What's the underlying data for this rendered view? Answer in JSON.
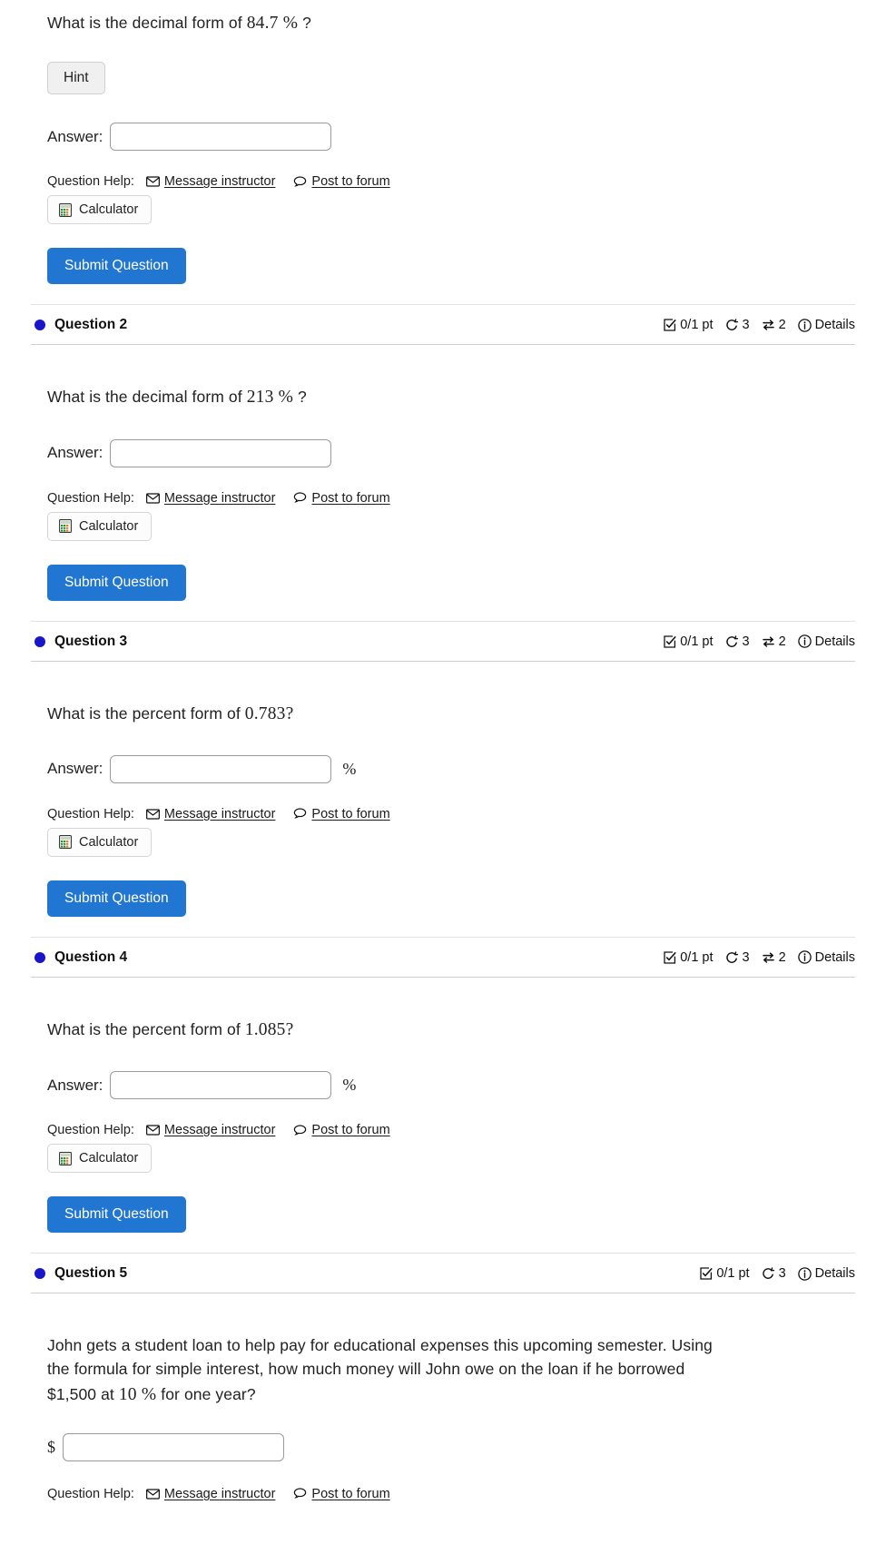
{
  "common": {
    "answer_label": "Answer:",
    "answer_value": "",
    "answer_placeholder": "",
    "question_help_label": "Question Help:",
    "message_instructor": "Message instructor",
    "post_to_forum": "Post to forum",
    "calculator": "Calculator",
    "submit": "Submit Question",
    "hint": "Hint",
    "percent_unit": "%",
    "dollar_unit": "$",
    "details": "Details",
    "icons": {
      "envelope": "envelope-icon",
      "speech_bubble": "speech-bubble-icon",
      "calculator": "calculator-icon",
      "checkbox": "checked-box-icon",
      "retry": "retry-arrow-icon",
      "swap": "swap-arrows-icon",
      "info": "info-circle-icon",
      "status_dot": "status-dot-icon"
    },
    "colors": {
      "submit_blue": "#2176d2",
      "status_dot": "#1816c8",
      "divider": "#cfcfcf",
      "input_border": "#9a9a9a"
    }
  },
  "questions": [
    {
      "id": "q1",
      "has_header": false,
      "title": "",
      "prompt_prefix": "What is the decimal form of ",
      "prompt_math": "84.7",
      "prompt_math_unit": "%",
      "prompt_suffix": "?",
      "has_hint": true,
      "answer_suffix": "",
      "answer_prefix": "",
      "stats": {}
    },
    {
      "id": "q2",
      "has_header": true,
      "title": "Question 2",
      "prompt_prefix": "What is the decimal form of ",
      "prompt_math": "213",
      "prompt_math_unit": "%",
      "prompt_suffix": "?",
      "has_hint": false,
      "answer_suffix": "",
      "answer_prefix": "",
      "stats": {
        "points": "0/1 pt",
        "retries": "3",
        "swaps": "2",
        "details": "Details",
        "show_swap": true
      }
    },
    {
      "id": "q3",
      "has_header": true,
      "title": "Question 3",
      "prompt_prefix": "What is the percent form of ",
      "prompt_math": "0.783",
      "prompt_math_unit": "",
      "prompt_suffix": "?",
      "has_hint": false,
      "answer_suffix": "%",
      "answer_prefix": "",
      "stats": {
        "points": "0/1 pt",
        "retries": "3",
        "swaps": "2",
        "details": "Details",
        "show_swap": true
      }
    },
    {
      "id": "q4",
      "has_header": true,
      "title": "Question 4",
      "prompt_prefix": "What is the percent form of ",
      "prompt_math": "1.085",
      "prompt_math_unit": "",
      "prompt_suffix": "?",
      "has_hint": false,
      "answer_suffix": "%",
      "answer_prefix": "",
      "stats": {
        "points": "0/1 pt",
        "retries": "3",
        "swaps": "2",
        "details": "Details",
        "show_swap": true
      }
    },
    {
      "id": "q5",
      "has_header": true,
      "title": "Question 5",
      "word_problem_line1": "John gets a student loan to help pay for educational expenses this upcoming semester. Using",
      "word_problem_line2_a": "the formula for simple interest, how much money will John owe on the loan if he borrowed",
      "word_problem_line3_a": "$1,500 at ",
      "word_problem_line3_math": "10",
      "word_problem_line3_unit": "%",
      "word_problem_line3_b": " for one year?",
      "has_hint": false,
      "answer_prefix": "$",
      "stats": {
        "points": "0/1 pt",
        "retries": "3",
        "swaps": "",
        "details": "Details",
        "show_swap": false
      }
    }
  ]
}
